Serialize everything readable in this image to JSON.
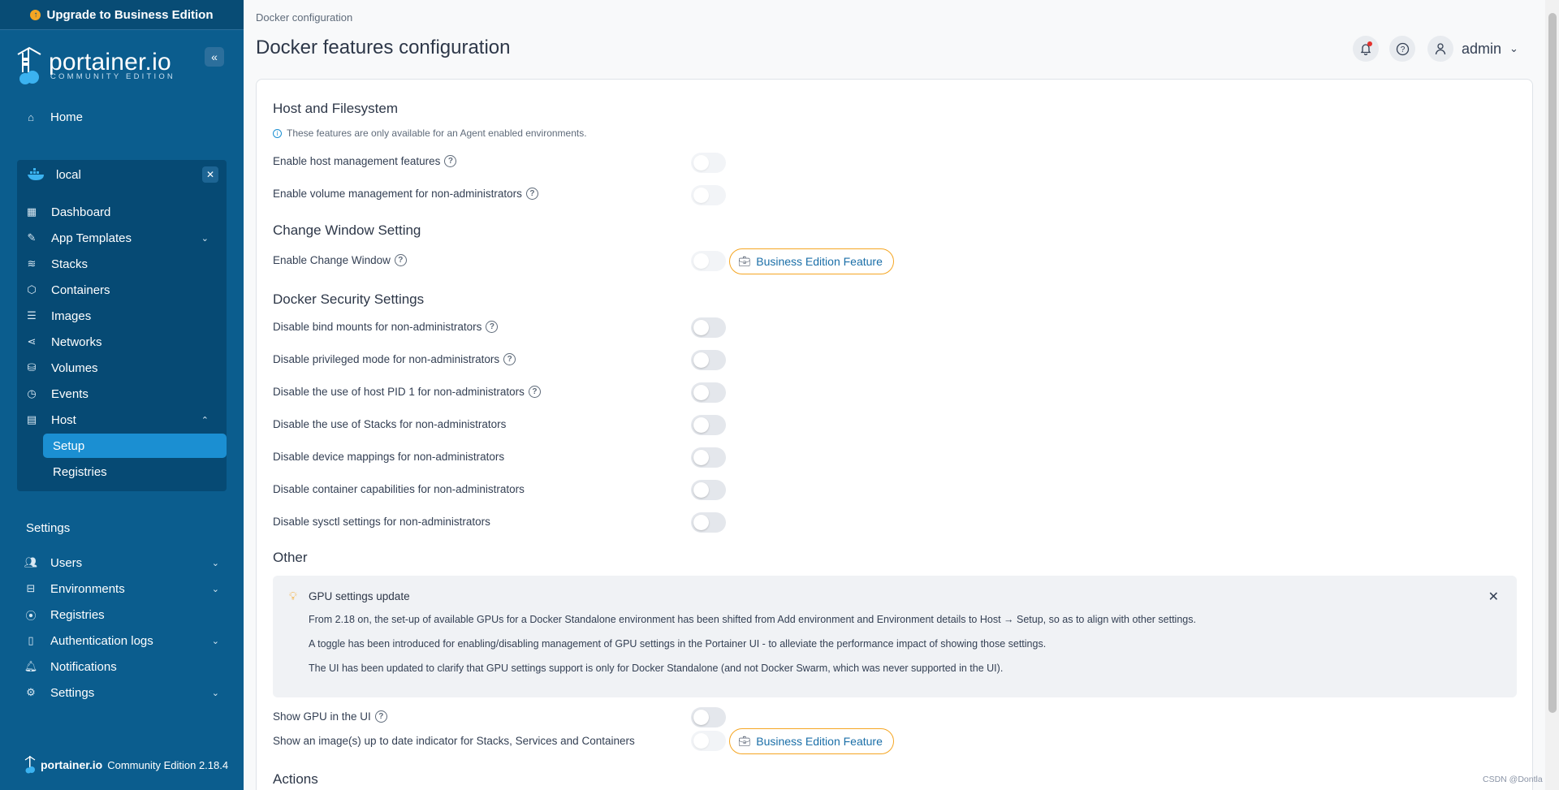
{
  "sidebar": {
    "upgrade_label": "Upgrade to Business Edition",
    "brand_name": "portainer.io",
    "brand_subtitle": "COMMUNITY EDITION",
    "home_label": "Home",
    "environment": {
      "name": "local",
      "items": [
        {
          "label": "Dashboard",
          "icon": "dashboard-icon"
        },
        {
          "label": "App Templates",
          "icon": "edit-icon"
        },
        {
          "label": "Stacks",
          "icon": "layers-icon"
        },
        {
          "label": "Containers",
          "icon": "box-icon"
        },
        {
          "label": "Images",
          "icon": "list-icon"
        },
        {
          "label": "Networks",
          "icon": "share-icon"
        },
        {
          "label": "Volumes",
          "icon": "database-icon"
        },
        {
          "label": "Events",
          "icon": "clock-icon"
        },
        {
          "label": "Host",
          "icon": "server-icon"
        }
      ],
      "host_subitems": [
        "Setup",
        "Registries"
      ]
    },
    "settings_heading": "Settings",
    "settings_items": [
      {
        "label": "Users",
        "icon": "users-icon"
      },
      {
        "label": "Environments",
        "icon": "hard-drive-icon"
      },
      {
        "label": "Registries",
        "icon": "radio-icon"
      },
      {
        "label": "Authentication logs",
        "icon": "file-icon"
      },
      {
        "label": "Notifications",
        "icon": "bell-icon"
      },
      {
        "label": "Settings",
        "icon": "gear-icon"
      }
    ],
    "footer_brand": "portainer.io",
    "footer_version": "Community Edition 2.18.4"
  },
  "header": {
    "breadcrumb": "Docker configuration",
    "title": "Docker features configuration",
    "user": "admin"
  },
  "host_fs": {
    "title": "Host and Filesystem",
    "note": "These features are only available for an Agent enabled environments.",
    "rows": [
      "Enable host management features",
      "Enable volume management for non-administrators"
    ]
  },
  "change_window": {
    "title": "Change Window Setting",
    "row": "Enable Change Window",
    "badge": "Business Edition Feature"
  },
  "security": {
    "title": "Docker Security Settings",
    "rows": [
      "Disable bind mounts for non-administrators",
      "Disable privileged mode for non-administrators",
      "Disable the use of host PID 1 for non-administrators",
      "Disable the use of Stacks for non-administrators",
      "Disable device mappings for non-administrators",
      "Disable container capabilities for non-administrators",
      "Disable sysctl settings for non-administrators"
    ]
  },
  "other": {
    "title": "Other",
    "alert": {
      "title": "GPU settings update",
      "lines": [
        "From 2.18 on, the set-up of available GPUs for a Docker Standalone environment has been shifted from Add environment and Environment details to Host → Setup, so as to align with other settings.",
        "A toggle has been introduced for enabling/disabling management of GPU settings in the Portainer UI - to alleviate the performance impact of showing those settings.",
        "The UI has been updated to clarify that GPU settings support is only for Docker Standalone (and not Docker Swarm, which was never supported in the UI)."
      ]
    },
    "show_gpu": "Show GPU in the UI",
    "image_indicator": "Show an image(s) up to date indicator for Stacks, Services and Containers",
    "badge": "Business Edition Feature"
  },
  "actions_title": "Actions",
  "watermark": "CSDN @Dontla"
}
